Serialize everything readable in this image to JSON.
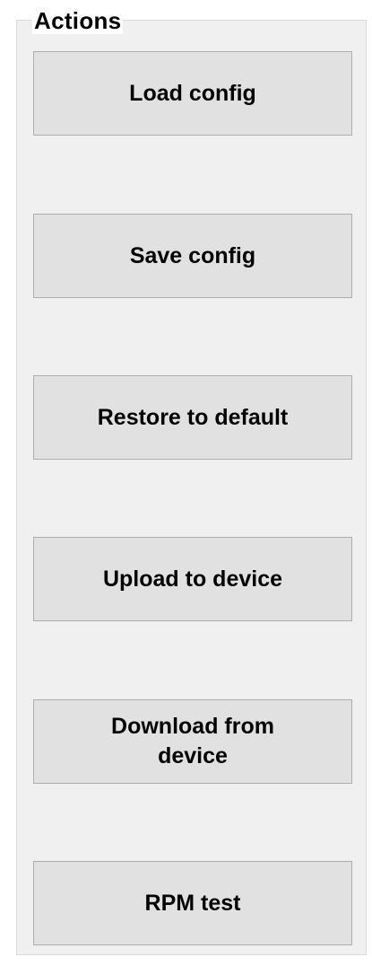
{
  "groupbox": {
    "title": "Actions"
  },
  "buttons": {
    "load_config": "Load config",
    "save_config": "Save config",
    "restore_default": "Restore to default",
    "upload_device": "Upload to device",
    "download_device": "Download from\ndevice",
    "rpm_test": "RPM test"
  }
}
